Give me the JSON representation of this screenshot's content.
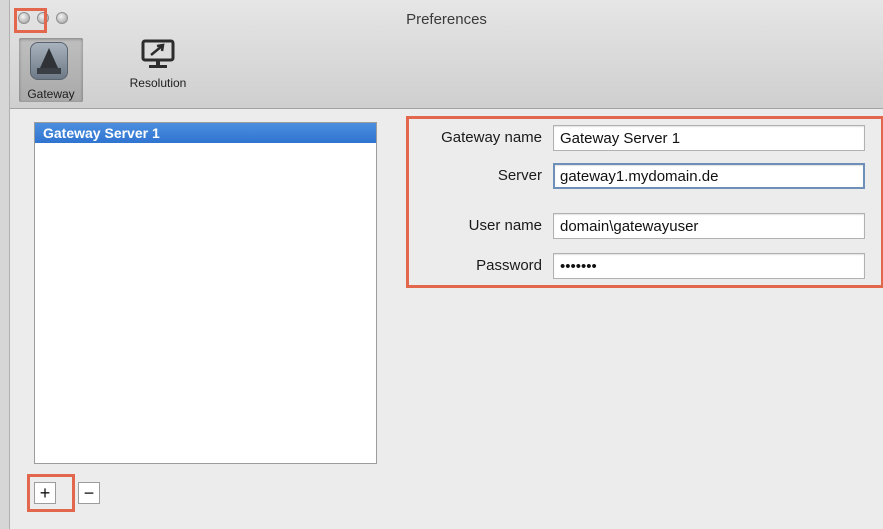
{
  "window": {
    "title": "Preferences"
  },
  "toolbar": {
    "gateway_label": "Gateway",
    "resolution_label": "Resolution"
  },
  "servers": {
    "items": [
      "Gateway Server 1"
    ],
    "selected": "Gateway Server 1"
  },
  "list_controls": {
    "add_label": "+",
    "remove_label": "−"
  },
  "form": {
    "gateway_name": {
      "label": "Gateway name",
      "value": "Gateway Server 1"
    },
    "server": {
      "label": "Server",
      "value": "gateway1.mydomain.de"
    },
    "user_name": {
      "label": "User name",
      "value": "domain\\gatewayuser"
    },
    "password": {
      "label": "Password",
      "value": "•••••••"
    }
  },
  "colors": {
    "highlight": "#e2674d",
    "selection": "#3a7fd8"
  }
}
